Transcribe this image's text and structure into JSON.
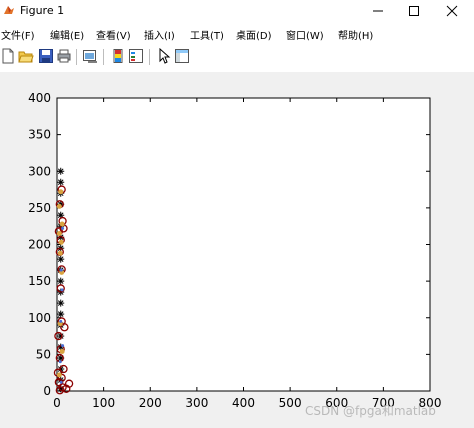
{
  "window": {
    "title": "Figure 1"
  },
  "menu": [
    {
      "label": "文件(F)"
    },
    {
      "label": "编辑(E)"
    },
    {
      "label": "查看(V)"
    },
    {
      "label": "插入(I)"
    },
    {
      "label": "工具(T)"
    },
    {
      "label": "桌面(D)"
    },
    {
      "label": "窗口(W)"
    },
    {
      "label": "帮助(H)"
    }
  ],
  "toolbar": {
    "icons": [
      "new-figure-icon",
      "open-file-icon",
      "save-icon",
      "print-icon",
      "link-plot-icon",
      "colorbar-icon",
      "legend-icon",
      "edit-plot-icon",
      "property-inspector-icon"
    ]
  },
  "watermark": "CSDN @fpga和matlab",
  "chart_data": {
    "type": "scatter",
    "xlim": [
      0,
      800
    ],
    "ylim": [
      0,
      400
    ],
    "x_ticks": [
      0,
      100,
      200,
      300,
      400,
      500,
      600,
      700,
      800
    ],
    "y_ticks": [
      0,
      50,
      100,
      150,
      200,
      250,
      300,
      350,
      400
    ],
    "grid": false,
    "series": [
      {
        "marker": "asterisk",
        "color": "#000000",
        "points": [
          [
            8,
            300
          ],
          [
            8,
            285
          ],
          [
            8,
            270
          ],
          [
            8,
            255
          ],
          [
            8,
            240
          ],
          [
            8,
            225
          ],
          [
            8,
            210
          ],
          [
            8,
            195
          ],
          [
            8,
            180
          ],
          [
            8,
            165
          ],
          [
            8,
            150
          ],
          [
            8,
            135
          ],
          [
            8,
            120
          ],
          [
            8,
            105
          ],
          [
            8,
            90
          ],
          [
            8,
            75
          ],
          [
            8,
            60
          ],
          [
            8,
            45
          ],
          [
            8,
            30
          ],
          [
            8,
            15
          ],
          [
            8,
            3
          ]
        ]
      },
      {
        "marker": "circle",
        "color": "#8b0000",
        "points": [
          [
            10,
            275
          ],
          [
            6,
            255
          ],
          [
            12,
            232
          ],
          [
            4,
            218
          ],
          [
            14,
            222
          ],
          [
            8,
            206
          ],
          [
            6,
            190
          ],
          [
            10,
            166
          ],
          [
            8,
            140
          ],
          [
            10,
            95
          ],
          [
            16,
            87
          ],
          [
            3,
            75
          ],
          [
            8,
            57
          ],
          [
            6,
            45
          ],
          [
            2,
            25
          ],
          [
            14,
            30
          ],
          [
            10,
            18
          ],
          [
            4,
            12
          ],
          [
            26,
            10
          ],
          [
            12,
            5
          ],
          [
            20,
            3
          ],
          [
            6,
            1
          ]
        ]
      },
      {
        "marker": "circle-filled",
        "color": "#d9a441",
        "points": [
          [
            8,
            272
          ],
          [
            5,
            252
          ],
          [
            11,
            228
          ],
          [
            5,
            215
          ],
          [
            9,
            203
          ],
          [
            7,
            188
          ],
          [
            10,
            162
          ],
          [
            7,
            92
          ],
          [
            11,
            54
          ],
          [
            5,
            22
          ]
        ]
      },
      {
        "marker": "dot",
        "color": "#4a6fd6",
        "points": [
          [
            12,
            222
          ],
          [
            9,
            165
          ],
          [
            11,
            138
          ],
          [
            8,
            95
          ],
          [
            12,
            62
          ],
          [
            7,
            40
          ],
          [
            9,
            12
          ]
        ]
      }
    ]
  }
}
